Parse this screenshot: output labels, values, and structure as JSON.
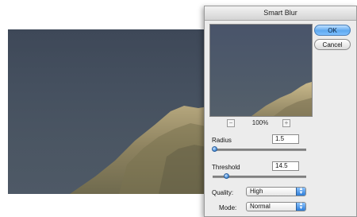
{
  "dialog": {
    "title": "Smart Blur",
    "ok_label": "OK",
    "cancel_label": "Cancel"
  },
  "preview": {
    "zoom_level": "100%",
    "zoom_out_icon": "minus-icon",
    "zoom_in_icon": "plus-icon"
  },
  "radius": {
    "label": "Radius",
    "value": "1.5",
    "slider_fraction": 0.015
  },
  "threshold": {
    "label": "Threshold",
    "value": "14.5",
    "slider_fraction": 0.145
  },
  "quality": {
    "label": "Quality:",
    "selected": "High"
  },
  "mode": {
    "label": "Mode:",
    "selected": "Normal"
  },
  "colors": {
    "sky": "#45505f",
    "mountain": "#9d9068",
    "accent_blue": "#3c86d6"
  }
}
